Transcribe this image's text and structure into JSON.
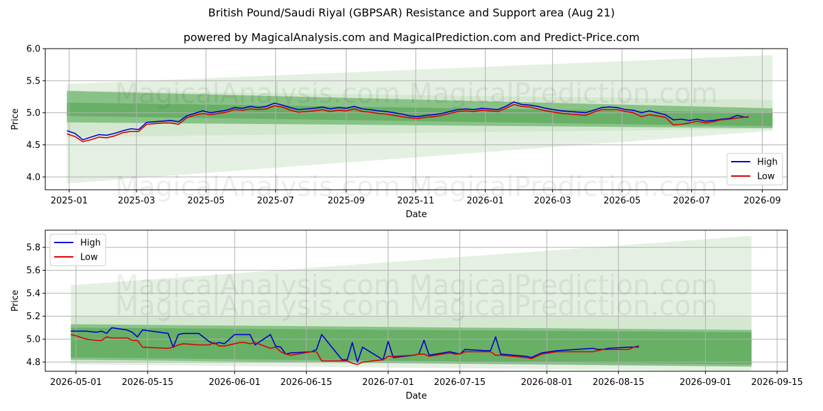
{
  "title": "British Pound/Saudi Riyal (GBPSAR) Resistance and Support area (Aug 21)",
  "subtitle": "powered by MagicalAnalysis.com and MagicalPrediction.com and Predict-Price.com",
  "watermark": "MagicalAnalysis.com   MagicalPrediction.com",
  "colors": {
    "high": "#0000cc",
    "low": "#dd0000",
    "band_light": "#bcdcb6",
    "band_dark": "#4aa24a",
    "grid": "#b0b0b0"
  },
  "chart_data": [
    {
      "type": "line",
      "xlabel": "Date",
      "ylabel": "Price",
      "ylim": [
        3.8,
        6.0
      ],
      "yticks": [
        "4.0",
        "4.5",
        "5.0",
        "5.5",
        "6.0"
      ],
      "xlim": [
        "2024-12-11",
        "2026-09-23"
      ],
      "xticks": [
        "2025-01",
        "2025-03",
        "2025-05",
        "2025-07",
        "2025-09",
        "2025-11",
        "2026-01",
        "2026-03",
        "2026-05",
        "2026-07",
        "2026-09"
      ],
      "grid": true,
      "legend_position": "lower-right",
      "series": [
        {
          "name": "High",
          "x": [
            "2024-12-30",
            "2025-01-06",
            "2025-01-13",
            "2025-01-20",
            "2025-01-27",
            "2025-02-03",
            "2025-02-10",
            "2025-02-17",
            "2025-02-24",
            "2025-03-03",
            "2025-03-10",
            "2025-03-17",
            "2025-03-24",
            "2025-03-31",
            "2025-04-07",
            "2025-04-14",
            "2025-04-21",
            "2025-04-28",
            "2025-05-05",
            "2025-05-12",
            "2025-05-19",
            "2025-05-26",
            "2025-06-02",
            "2025-06-09",
            "2025-06-16",
            "2025-06-23",
            "2025-06-30",
            "2025-07-07",
            "2025-07-14",
            "2025-07-21",
            "2025-07-28",
            "2025-08-04",
            "2025-08-11",
            "2025-08-18",
            "2025-08-25",
            "2025-09-01",
            "2025-09-08",
            "2025-09-15",
            "2025-09-22",
            "2025-09-29",
            "2025-10-06",
            "2025-10-13",
            "2025-10-20",
            "2025-10-27",
            "2025-11-03",
            "2025-11-10",
            "2025-11-17",
            "2025-11-24",
            "2025-12-01",
            "2025-12-08",
            "2025-12-15",
            "2025-12-22",
            "2025-12-29",
            "2026-01-05",
            "2026-01-12",
            "2026-01-19",
            "2026-01-26",
            "2026-02-02",
            "2026-02-09",
            "2026-02-16",
            "2026-02-23",
            "2026-03-02",
            "2026-03-09",
            "2026-03-16",
            "2026-03-23",
            "2026-03-30",
            "2026-04-06",
            "2026-04-13",
            "2026-04-20",
            "2026-04-27",
            "2026-05-04",
            "2026-05-11",
            "2026-05-18",
            "2026-05-25",
            "2026-06-01",
            "2026-06-08",
            "2026-06-15",
            "2026-06-22",
            "2026-06-29",
            "2026-07-06",
            "2026-07-13",
            "2026-07-20",
            "2026-07-27",
            "2026-08-03",
            "2026-08-10",
            "2026-08-17",
            "2026-08-20"
          ],
          "values": [
            4.72,
            4.68,
            4.58,
            4.62,
            4.66,
            4.65,
            4.68,
            4.72,
            4.75,
            4.74,
            4.85,
            4.86,
            4.87,
            4.88,
            4.86,
            4.95,
            4.99,
            5.03,
            5.0,
            5.02,
            5.04,
            5.08,
            5.07,
            5.1,
            5.08,
            5.1,
            5.15,
            5.12,
            5.08,
            5.05,
            5.06,
            5.07,
            5.09,
            5.06,
            5.08,
            5.07,
            5.1,
            5.06,
            5.05,
            5.03,
            5.02,
            5.0,
            4.98,
            4.95,
            4.94,
            4.96,
            4.97,
            4.99,
            5.02,
            5.05,
            5.06,
            5.05,
            5.07,
            5.06,
            5.05,
            5.1,
            5.17,
            5.13,
            5.12,
            5.1,
            5.07,
            5.05,
            5.03,
            5.02,
            5.01,
            5.0,
            5.04,
            5.08,
            5.09,
            5.08,
            5.05,
            5.04,
            5.0,
            5.03,
            5.0,
            4.97,
            4.89,
            4.9,
            4.88,
            4.9,
            4.87,
            4.88,
            4.9,
            4.91,
            4.96,
            4.93,
            4.94
          ]
        },
        {
          "name": "Low",
          "x": [
            "2024-12-30",
            "2025-01-06",
            "2025-01-13",
            "2025-01-20",
            "2025-01-27",
            "2025-02-03",
            "2025-02-10",
            "2025-02-17",
            "2025-02-24",
            "2025-03-03",
            "2025-03-10",
            "2025-03-17",
            "2025-03-24",
            "2025-03-31",
            "2025-04-07",
            "2025-04-14",
            "2025-04-21",
            "2025-04-28",
            "2025-05-05",
            "2025-05-12",
            "2025-05-19",
            "2025-05-26",
            "2025-06-02",
            "2025-06-09",
            "2025-06-16",
            "2025-06-23",
            "2025-06-30",
            "2025-07-07",
            "2025-07-14",
            "2025-07-21",
            "2025-07-28",
            "2025-08-04",
            "2025-08-11",
            "2025-08-18",
            "2025-08-25",
            "2025-09-01",
            "2025-09-08",
            "2025-09-15",
            "2025-09-22",
            "2025-09-29",
            "2025-10-06",
            "2025-10-13",
            "2025-10-20",
            "2025-10-27",
            "2025-11-03",
            "2025-11-10",
            "2025-11-17",
            "2025-11-24",
            "2025-12-01",
            "2025-12-08",
            "2025-12-15",
            "2025-12-22",
            "2025-12-29",
            "2026-01-05",
            "2026-01-12",
            "2026-01-19",
            "2026-01-26",
            "2026-02-02",
            "2026-02-09",
            "2026-02-16",
            "2026-02-23",
            "2026-03-02",
            "2026-03-09",
            "2026-03-16",
            "2026-03-23",
            "2026-03-30",
            "2026-04-06",
            "2026-04-13",
            "2026-04-20",
            "2026-04-27",
            "2026-05-04",
            "2026-05-11",
            "2026-05-18",
            "2026-05-25",
            "2026-06-01",
            "2026-06-08",
            "2026-06-15",
            "2026-06-22",
            "2026-06-29",
            "2026-07-06",
            "2026-07-13",
            "2026-07-20",
            "2026-07-27",
            "2026-08-03",
            "2026-08-10",
            "2026-08-17",
            "2026-08-20"
          ],
          "values": [
            4.67,
            4.63,
            4.55,
            4.58,
            4.62,
            4.61,
            4.64,
            4.69,
            4.71,
            4.71,
            4.82,
            4.83,
            4.84,
            4.84,
            4.82,
            4.92,
            4.96,
            4.99,
            4.97,
            4.99,
            5.01,
            5.05,
            5.04,
            5.06,
            5.05,
            5.06,
            5.11,
            5.09,
            5.04,
            5.01,
            5.02,
            5.03,
            5.05,
            5.02,
            5.04,
            5.03,
            5.06,
            5.02,
            5.01,
            4.99,
            4.98,
            4.96,
            4.94,
            4.92,
            4.91,
            4.93,
            4.94,
            4.96,
            4.99,
            5.02,
            5.03,
            5.02,
            5.04,
            5.03,
            5.02,
            5.07,
            5.13,
            5.1,
            5.09,
            5.06,
            5.03,
            5.01,
            4.99,
            4.98,
            4.97,
            4.96,
            5.01,
            5.05,
            5.05,
            5.05,
            5.02,
            5.0,
            4.94,
            4.97,
            4.95,
            4.93,
            4.81,
            4.82,
            4.84,
            4.87,
            4.84,
            4.86,
            4.89,
            4.9,
            4.92,
            4.93,
            4.93
          ]
        }
      ],
      "bands": [
        {
          "from": "2024-12-30",
          "to": "2026-09-10",
          "upper": [
            5.45,
            5.9
          ],
          "lower": [
            3.9,
            4.72
          ],
          "shade": "light"
        },
        {
          "from": "2024-12-30",
          "to": "2026-09-10",
          "upper": [
            5.35,
            5.2
          ],
          "lower": [
            4.62,
            4.75
          ],
          "shade": "light"
        },
        {
          "from": "2024-12-30",
          "to": "2026-09-10",
          "upper": [
            5.34,
            5.07
          ],
          "lower": [
            4.95,
            4.79
          ],
          "shade": "dark"
        },
        {
          "from": "2024-12-30",
          "to": "2026-09-10",
          "upper": [
            5.16,
            5.0
          ],
          "lower": [
            4.85,
            4.76
          ],
          "shade": "dark"
        }
      ]
    },
    {
      "type": "line",
      "xlabel": "Date",
      "ylabel": "Price",
      "ylim": [
        4.72,
        5.95
      ],
      "yticks": [
        "4.8",
        "5.0",
        "5.2",
        "5.4",
        "5.6",
        "5.8"
      ],
      "xlim": [
        "2026-04-25",
        "2026-09-17"
      ],
      "xticks": [
        "2026-05-01",
        "2026-05-15",
        "2026-06-01",
        "2026-06-15",
        "2026-07-01",
        "2026-07-15",
        "2026-08-01",
        "2026-08-15",
        "2026-09-01",
        "2026-09-15"
      ],
      "grid": true,
      "legend_position": "upper-left",
      "series": [
        {
          "name": "High",
          "x": [
            "2026-04-30",
            "2026-05-03",
            "2026-05-05",
            "2026-05-06",
            "2026-05-07",
            "2026-05-08",
            "2026-05-11",
            "2026-05-12",
            "2026-05-13",
            "2026-05-14",
            "2026-05-19",
            "2026-05-20",
            "2026-05-21",
            "2026-05-22",
            "2026-05-25",
            "2026-05-27",
            "2026-05-28",
            "2026-05-29",
            "2026-05-30",
            "2026-06-01",
            "2026-06-02",
            "2026-06-03",
            "2026-06-04",
            "2026-06-05",
            "2026-06-08",
            "2026-06-09",
            "2026-06-10",
            "2026-06-11",
            "2026-06-12",
            "2026-06-16",
            "2026-06-17",
            "2026-06-18",
            "2026-06-22",
            "2026-06-23",
            "2026-06-24",
            "2026-06-25",
            "2026-06-26",
            "2026-06-30",
            "2026-07-01",
            "2026-07-02",
            "2026-07-06",
            "2026-07-07",
            "2026-07-08",
            "2026-07-09",
            "2026-07-13",
            "2026-07-14",
            "2026-07-15",
            "2026-07-16",
            "2026-07-20",
            "2026-07-21",
            "2026-07-22",
            "2026-07-23",
            "2026-07-28",
            "2026-07-29",
            "2026-07-31",
            "2026-08-03",
            "2026-08-10",
            "2026-08-11",
            "2026-08-12",
            "2026-08-13",
            "2026-08-17",
            "2026-08-18",
            "2026-08-19"
          ],
          "values": [
            5.07,
            5.07,
            5.06,
            5.07,
            5.05,
            5.1,
            5.08,
            5.06,
            5.02,
            5.08,
            5.05,
            4.93,
            5.04,
            5.05,
            5.05,
            4.98,
            4.96,
            4.97,
            4.96,
            5.04,
            5.04,
            5.04,
            5.04,
            4.95,
            5.04,
            4.94,
            4.93,
            4.87,
            4.88,
            4.89,
            4.91,
            5.04,
            4.82,
            4.82,
            4.97,
            4.8,
            4.93,
            4.82,
            4.98,
            4.84,
            4.86,
            4.87,
            4.99,
            4.86,
            4.89,
            4.88,
            4.87,
            4.91,
            4.9,
            4.9,
            5.02,
            4.87,
            4.85,
            4.84,
            4.88,
            4.9,
            4.92,
            4.91,
            4.91,
            4.92,
            4.93,
            4.93,
            4.94
          ]
        },
        {
          "name": "Low",
          "x": [
            "2026-04-30",
            "2026-05-01",
            "2026-05-03",
            "2026-05-05",
            "2026-05-06",
            "2026-05-07",
            "2026-05-08",
            "2026-05-11",
            "2026-05-12",
            "2026-05-13",
            "2026-05-14",
            "2026-05-19",
            "2026-05-20",
            "2026-05-21",
            "2026-05-22",
            "2026-05-25",
            "2026-05-27",
            "2026-05-28",
            "2026-05-29",
            "2026-05-30",
            "2026-06-01",
            "2026-06-02",
            "2026-06-03",
            "2026-06-04",
            "2026-06-05",
            "2026-06-08",
            "2026-06-09",
            "2026-06-10",
            "2026-06-11",
            "2026-06-12",
            "2026-06-16",
            "2026-06-17",
            "2026-06-18",
            "2026-06-22",
            "2026-06-23",
            "2026-06-24",
            "2026-06-25",
            "2026-06-26",
            "2026-06-30",
            "2026-07-01",
            "2026-07-02",
            "2026-07-06",
            "2026-07-07",
            "2026-07-08",
            "2026-07-09",
            "2026-07-13",
            "2026-07-14",
            "2026-07-15",
            "2026-07-16",
            "2026-07-20",
            "2026-07-21",
            "2026-07-22",
            "2026-07-23",
            "2026-07-28",
            "2026-07-29",
            "2026-07-31",
            "2026-08-03",
            "2026-08-10",
            "2026-08-11",
            "2026-08-12",
            "2026-08-13",
            "2026-08-17",
            "2026-08-18",
            "2026-08-19"
          ],
          "values": [
            5.04,
            5.03,
            5.0,
            4.99,
            4.99,
            5.02,
            5.01,
            5.01,
            4.99,
            4.99,
            4.93,
            4.92,
            4.93,
            4.95,
            4.96,
            4.95,
            4.95,
            4.97,
            4.94,
            4.94,
            4.96,
            4.97,
            4.97,
            4.96,
            4.97,
            4.92,
            4.93,
            4.89,
            4.87,
            4.86,
            4.89,
            4.89,
            4.81,
            4.81,
            4.81,
            4.79,
            4.78,
            4.8,
            4.82,
            4.85,
            4.85,
            4.86,
            4.87,
            4.87,
            4.85,
            4.88,
            4.87,
            4.87,
            4.89,
            4.89,
            4.89,
            4.86,
            4.86,
            4.84,
            4.83,
            4.87,
            4.89,
            4.89,
            4.9,
            4.91,
            4.91,
            4.91,
            4.93,
            4.93
          ]
        }
      ],
      "bands": [
        {
          "from": "2026-04-30",
          "to": "2026-09-10",
          "upper": [
            5.47,
            5.9
          ],
          "lower": [
            4.78,
            4.72
          ],
          "shade": "light"
        },
        {
          "from": "2026-04-30",
          "to": "2026-09-10",
          "upper": [
            5.2,
            5.19
          ],
          "lower": [
            4.8,
            4.77
          ],
          "shade": "light"
        },
        {
          "from": "2026-04-30",
          "to": "2026-09-10",
          "upper": [
            5.13,
            5.08
          ],
          "lower": [
            4.82,
            4.76
          ],
          "shade": "dark"
        },
        {
          "from": "2026-04-30",
          "to": "2026-09-10",
          "upper": [
            5.1,
            5.06
          ],
          "lower": [
            4.84,
            4.78
          ],
          "shade": "dark"
        }
      ]
    }
  ]
}
